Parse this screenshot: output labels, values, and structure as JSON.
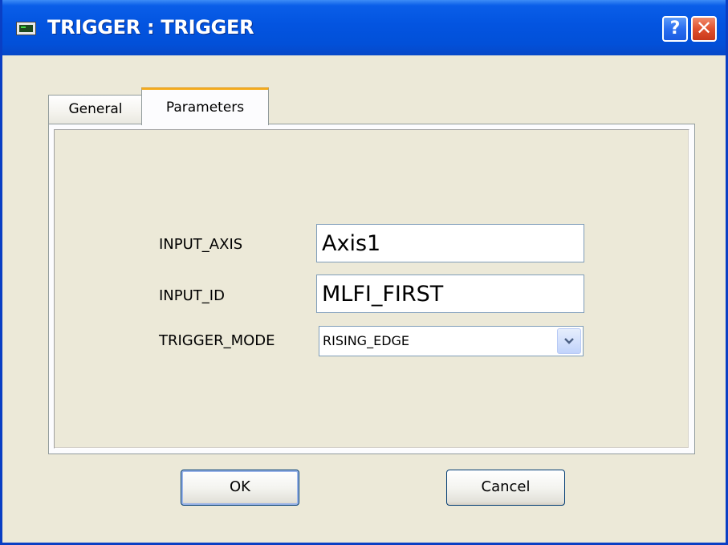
{
  "window": {
    "title": "TRIGGER : TRIGGER",
    "help_label": "?",
    "close_label": "✕",
    "app_icon": "terminal-icon"
  },
  "tabs": [
    {
      "label": "General",
      "active": false
    },
    {
      "label": "Parameters",
      "active": true
    }
  ],
  "form": {
    "input_axis": {
      "label": "INPUT_AXIS",
      "value": "Axis1"
    },
    "input_id": {
      "label": "INPUT_ID",
      "value": "MLFI_FIRST"
    },
    "trigger_mode": {
      "label": "TRIGGER_MODE",
      "value": "RISING_EDGE"
    }
  },
  "buttons": {
    "ok": "OK",
    "cancel": "Cancel"
  },
  "colors": {
    "titlebar": "#0354e0",
    "window_bg": "#ece9d8",
    "active_tab_accent": "#f7b32b",
    "field_border": "#7f9db9"
  }
}
